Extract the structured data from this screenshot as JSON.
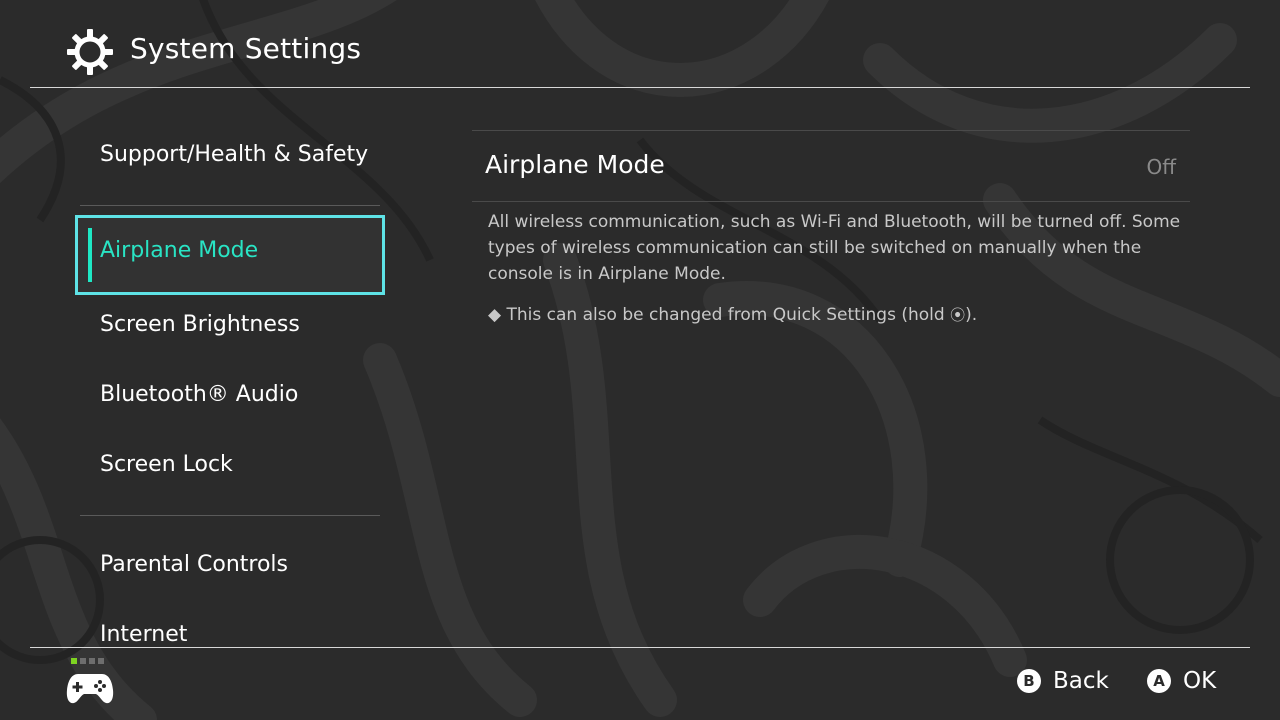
{
  "header": {
    "title": "System Settings",
    "icon": "gear-icon"
  },
  "sidebar": {
    "items": [
      {
        "label": "Support/Health & Safety"
      },
      {
        "label": "Airplane Mode",
        "selected": true
      },
      {
        "label": "Screen Brightness"
      },
      {
        "label": "Bluetooth® Audio"
      },
      {
        "label": "Screen Lock"
      },
      {
        "label": "Parental Controls"
      },
      {
        "label": "Internet"
      }
    ]
  },
  "detail": {
    "title": "Airplane Mode",
    "value": "Off",
    "description": "All wireless communication, such as Wi-Fi and Bluetooth, will be turned off. Some types of wireless communication can still be switched on manually when the console is in Airplane Mode.",
    "note_prefix": "◆ This can also be changed from Quick Settings (hold ",
    "note_glyph": "⦿",
    "note_suffix": ")."
  },
  "footer": {
    "page_indicator": {
      "total": 4,
      "active": 1
    },
    "back_key": "B",
    "back_label": "Back",
    "ok_key": "A",
    "ok_label": "OK"
  },
  "colors": {
    "background": "#2b2b2b",
    "selection_border": "#5ee3e6",
    "selection_text": "#29e4c4",
    "indicator_active": "#7ed321"
  }
}
